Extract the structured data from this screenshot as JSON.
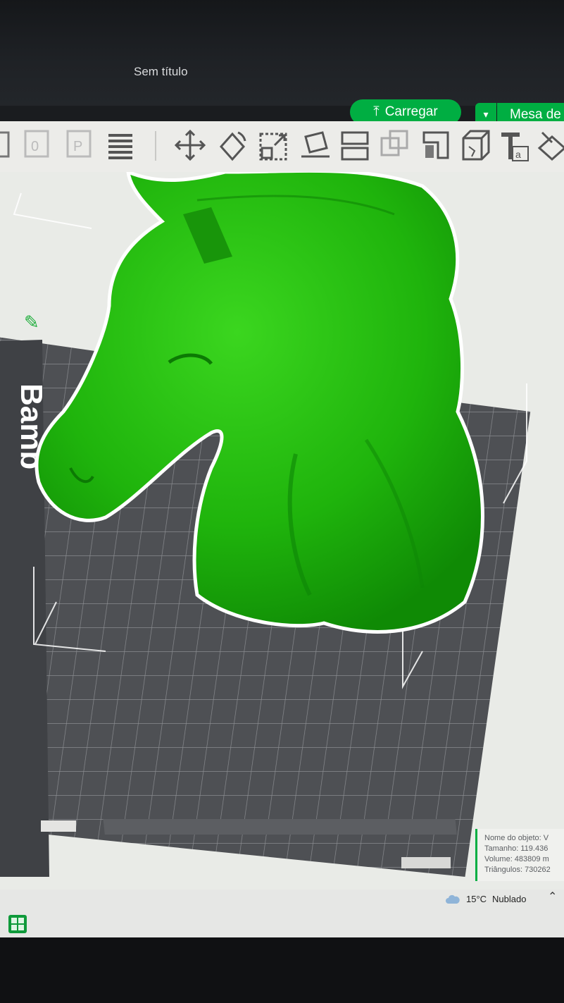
{
  "app": {
    "window_title": "Sem título"
  },
  "actions": {
    "load_label": "Carregar",
    "plate_label": "Mesa de t"
  },
  "toolbar": {
    "tools": [
      {
        "name": "open-icon"
      },
      {
        "name": "object-icon"
      },
      {
        "name": "plate-icon"
      },
      {
        "name": "arrange-icon"
      },
      {
        "name": "move-icon"
      },
      {
        "name": "rotate-icon"
      },
      {
        "name": "scale-icon"
      },
      {
        "name": "place-on-face-icon"
      },
      {
        "name": "split-icon"
      },
      {
        "name": "boolean-icon"
      },
      {
        "name": "support-paint-icon"
      },
      {
        "name": "cut-icon"
      },
      {
        "name": "text-icon"
      },
      {
        "name": "measure-icon"
      }
    ]
  },
  "viewport": {
    "bed_brand_label": "Bamb",
    "model_color": "#1fb40c",
    "bed_color": "#4e5054"
  },
  "object_info": {
    "name": "Nome do objeto: V",
    "size": "Tamanho: 119.436",
    "volume": "Volume: 483809 m",
    "triangles": "Triângulos: 730262"
  },
  "taskbar": {
    "temperature": "15°C",
    "weather": "Nublado"
  },
  "colors": {
    "accent": "#00ae42",
    "toolbar_bg": "#ecece9",
    "viewport_bg": "#e9ebe7"
  }
}
